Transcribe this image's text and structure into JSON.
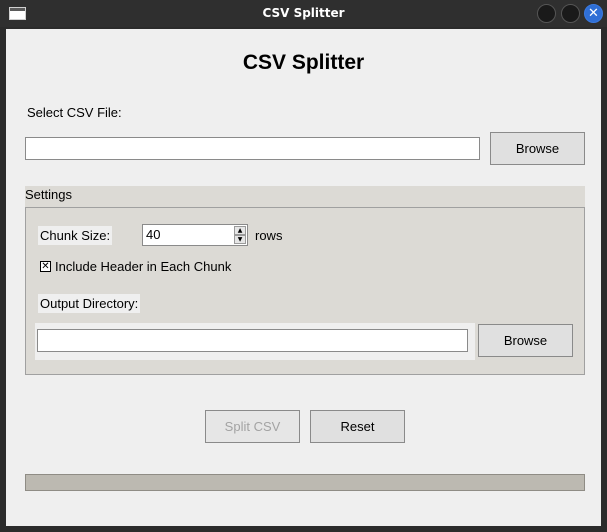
{
  "window": {
    "title": "CSV Splitter",
    "close_glyph": "✕"
  },
  "main": {
    "heading": "CSV Splitter",
    "select_label": "Select CSV File:",
    "file_path_value": "",
    "browse_file_label": "Browse"
  },
  "settings": {
    "title": "Settings",
    "chunk_size_label": "Chunk Size:",
    "chunk_size_value": "40",
    "chunk_unit": "rows",
    "include_header_checked": true,
    "include_header_label": "Include Header in Each Chunk",
    "check_glyph": "✕",
    "output_dir_label": "Output Directory:",
    "output_dir_value": "",
    "browse_dir_label": "Browse"
  },
  "actions": {
    "split_label": "Split CSV",
    "split_enabled": false,
    "reset_label": "Reset"
  },
  "progress": {
    "value": 0
  },
  "icons": {
    "up": "▲",
    "down": "▼"
  }
}
